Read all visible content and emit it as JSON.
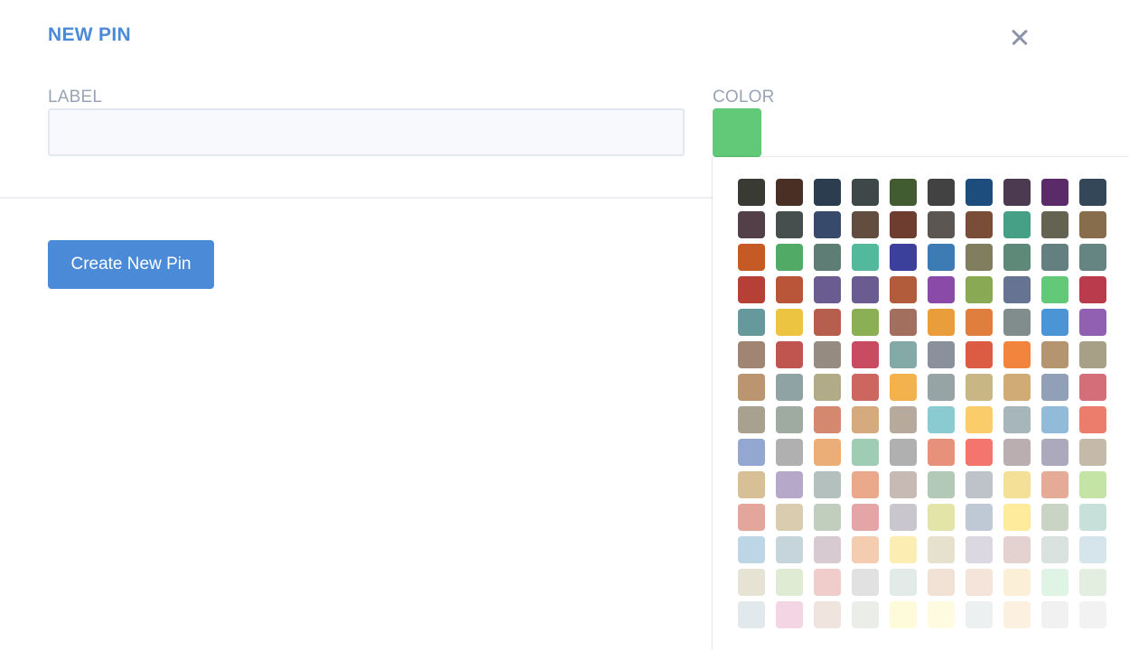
{
  "dialog": {
    "title": "NEW PIN"
  },
  "form": {
    "label_title": "LABEL",
    "label_value": "",
    "label_placeholder": "",
    "color_title": "COLOR",
    "selected_color": "#62c978",
    "submit_label": "Create New Pin"
  },
  "icons": {
    "close": "close-icon"
  },
  "palette": [
    "#383a33",
    "#4a3024",
    "#2c3d50",
    "#3e4848",
    "#425b30",
    "#424242",
    "#1c4d7c",
    "#4b3a50",
    "#5b2a68",
    "#344758",
    "#523f48",
    "#474f4e",
    "#374a6b",
    "#624d3e",
    "#6f3c30",
    "#5b5651",
    "#7a4d38",
    "#46a086",
    "#646351",
    "#876d4c",
    "#c55a25",
    "#52aa67",
    "#5e7d74",
    "#52b99c",
    "#3d409b",
    "#3c7bb4",
    "#807e5e",
    "#5e8978",
    "#647f80",
    "#648582",
    "#b63f36",
    "#b95639",
    "#6a5c91",
    "#6a5c91",
    "#b35c3c",
    "#8a4ba8",
    "#8aa955",
    "#667392",
    "#62c978",
    "#ba3b4b",
    "#66999c",
    "#ecc442",
    "#b65f4e",
    "#8aaf55",
    "#a26f5f",
    "#e99e3b",
    "#e07f3d",
    "#818c8d",
    "#4b95d7",
    "#9260b2",
    "#a08572",
    "#c0544f",
    "#968b80",
    "#c84b62",
    "#83aaa6",
    "#8a919c",
    "#db5c42",
    "#f2843e",
    "#b59470",
    "#a79f86",
    "#bb9470",
    "#8fa3a4",
    "#b1ab87",
    "#cc665f",
    "#f4b24d",
    "#97a4a6",
    "#c8b785",
    "#d0ab75",
    "#91a0b6",
    "#d46e79",
    "#a9a190",
    "#9faaa1",
    "#d4896e",
    "#d5aa7f",
    "#b8a99d",
    "#8acbd1",
    "#fbcc6a",
    "#a6b6bb",
    "#92bbd9",
    "#ec7c6b",
    "#93a7d1",
    "#b0b0b0",
    "#ecae78",
    "#9ecdb3",
    "#b0b0b0",
    "#e7907a",
    "#f4756c",
    "#bbaeb1",
    "#ada9bd",
    "#c5b9a9",
    "#d8c096",
    "#b6a8c9",
    "#b3c0bd",
    "#eaa98a",
    "#c7b9b4",
    "#b3c9b8",
    "#bec3c9",
    "#f4e097",
    "#e6ab97",
    "#c3e4a5",
    "#e4a59b",
    "#dacdaf",
    "#c1cdbd",
    "#e3a5a6",
    "#c9c6cd",
    "#e2e5a7",
    "#bfc9d6",
    "#feeb9b",
    "#c9d4c5",
    "#c8e0da",
    "#bdd6e6",
    "#c6d5dc",
    "#d8cad1",
    "#f4cdb1",
    "#fcedb2",
    "#e6e1cd",
    "#dbd8e2",
    "#e4d2d0",
    "#d9e2df",
    "#d6e5ec",
    "#e6e3d4",
    "#dfebd3",
    "#f0cdca",
    "#e1e1e2",
    "#e2ebe7",
    "#f2e2d5",
    "#f4e4d9",
    "#fbf0d7",
    "#dff4e5",
    "#e3ede0",
    "#e2e9ec",
    "#f4d5e4",
    "#f0e4df",
    "#ebeee8",
    "#fefbdb",
    "#fefbe0",
    "#ecf0f0",
    "#fcf1e0",
    "#f1f1f1",
    "#f2f2f2"
  ]
}
